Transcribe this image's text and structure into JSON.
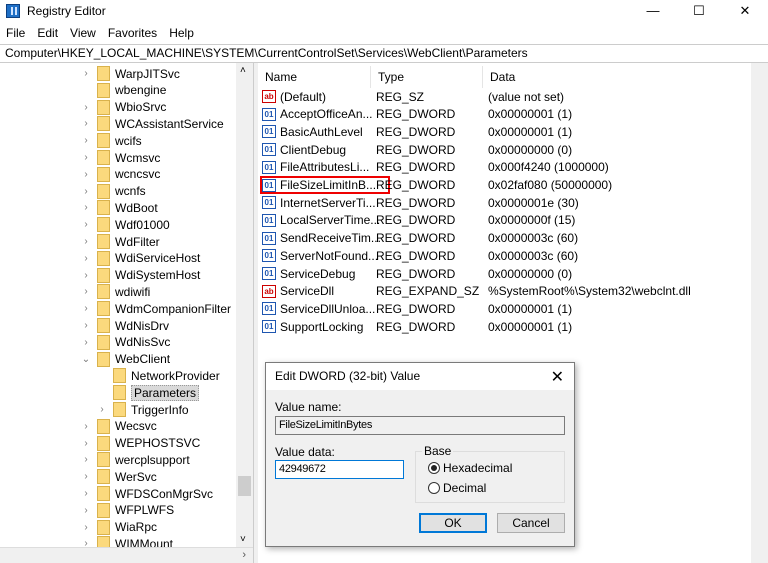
{
  "window": {
    "title": "Registry Editor",
    "minimize": "—",
    "maximize": "☐",
    "close": "✕"
  },
  "menu": [
    "File",
    "Edit",
    "View",
    "Favorites",
    "Help"
  ],
  "address": "Computer\\HKEY_LOCAL_MACHINE\\SYSTEM\\CurrentControlSet\\Services\\WebClient\\Parameters",
  "tree": [
    {
      "label": "WarpJITSvc",
      "level": 1,
      "expander": ">"
    },
    {
      "label": "wbengine",
      "level": 1,
      "expander": ""
    },
    {
      "label": "WbioSrvc",
      "level": 1,
      "expander": ">"
    },
    {
      "label": "WCAssistantService",
      "level": 1,
      "expander": ">"
    },
    {
      "label": "wcifs",
      "level": 1,
      "expander": ">"
    },
    {
      "label": "Wcmsvc",
      "level": 1,
      "expander": ">"
    },
    {
      "label": "wcncsvc",
      "level": 1,
      "expander": ">"
    },
    {
      "label": "wcnfs",
      "level": 1,
      "expander": ">"
    },
    {
      "label": "WdBoot",
      "level": 1,
      "expander": ">"
    },
    {
      "label": "Wdf01000",
      "level": 1,
      "expander": ">"
    },
    {
      "label": "WdFilter",
      "level": 1,
      "expander": ">"
    },
    {
      "label": "WdiServiceHost",
      "level": 1,
      "expander": ">"
    },
    {
      "label": "WdiSystemHost",
      "level": 1,
      "expander": ">"
    },
    {
      "label": "wdiwifi",
      "level": 1,
      "expander": ">"
    },
    {
      "label": "WdmCompanionFilter",
      "level": 1,
      "expander": ">"
    },
    {
      "label": "WdNisDrv",
      "level": 1,
      "expander": ">"
    },
    {
      "label": "WdNisSvc",
      "level": 1,
      "expander": ">"
    },
    {
      "label": "WebClient",
      "level": 1,
      "expander": "v"
    },
    {
      "label": "NetworkProvider",
      "level": 2,
      "expander": ""
    },
    {
      "label": "Parameters",
      "level": 2,
      "expander": "",
      "selected": true
    },
    {
      "label": "TriggerInfo",
      "level": 2,
      "expander": ">"
    },
    {
      "label": "Wecsvc",
      "level": 1,
      "expander": ">"
    },
    {
      "label": "WEPHOSTSVC",
      "level": 1,
      "expander": ">"
    },
    {
      "label": "wercplsupport",
      "level": 1,
      "expander": ">"
    },
    {
      "label": "WerSvc",
      "level": 1,
      "expander": ">"
    },
    {
      "label": "WFDSConMgrSvc",
      "level": 1,
      "expander": ">"
    },
    {
      "label": "WFPLWFS",
      "level": 1,
      "expander": ">"
    },
    {
      "label": "WiaRpc",
      "level": 1,
      "expander": ">"
    },
    {
      "label": "WIMMount",
      "level": 1,
      "expander": ">"
    }
  ],
  "columns": {
    "name": "Name",
    "type": "Type",
    "data": "Data"
  },
  "values": [
    {
      "name": "(Default)",
      "type": "REG_SZ",
      "data": "(value not set)",
      "icon": "ab"
    },
    {
      "name": "AcceptOfficeAn...",
      "type": "REG_DWORD",
      "data": "0x00000001 (1)",
      "icon": "dw"
    },
    {
      "name": "BasicAuthLevel",
      "type": "REG_DWORD",
      "data": "0x00000001 (1)",
      "icon": "dw"
    },
    {
      "name": "ClientDebug",
      "type": "REG_DWORD",
      "data": "0x00000000 (0)",
      "icon": "dw"
    },
    {
      "name": "FileAttributesLi...",
      "type": "REG_DWORD",
      "data": "0x000f4240 (1000000)",
      "icon": "dw"
    },
    {
      "name": "FileSizeLimitInB...",
      "type": "REG_DWORD",
      "data": "0x02faf080 (50000000)",
      "icon": "dw",
      "highlighted": true
    },
    {
      "name": "InternetServerTi...",
      "type": "REG_DWORD",
      "data": "0x0000001e (30)",
      "icon": "dw"
    },
    {
      "name": "LocalServerTime...",
      "type": "REG_DWORD",
      "data": "0x0000000f (15)",
      "icon": "dw"
    },
    {
      "name": "SendReceiveTim...",
      "type": "REG_DWORD",
      "data": "0x0000003c (60)",
      "icon": "dw"
    },
    {
      "name": "ServerNotFound...",
      "type": "REG_DWORD",
      "data": "0x0000003c (60)",
      "icon": "dw"
    },
    {
      "name": "ServiceDebug",
      "type": "REG_DWORD",
      "data": "0x00000000 (0)",
      "icon": "dw"
    },
    {
      "name": "ServiceDll",
      "type": "REG_EXPAND_SZ",
      "data": "%SystemRoot%\\System32\\webclnt.dll",
      "icon": "ab"
    },
    {
      "name": "ServiceDllUnloa...",
      "type": "REG_DWORD",
      "data": "0x00000001 (1)",
      "icon": "dw"
    },
    {
      "name": "SupportLocking",
      "type": "REG_DWORD",
      "data": "0x00000001 (1)",
      "icon": "dw"
    }
  ],
  "dialog": {
    "title": "Edit DWORD (32-bit) Value",
    "close": "✕",
    "value_name_label": "Value name:",
    "value_name": "FileSizeLimitInBytes",
    "value_data_label": "Value data:",
    "value_data": "42949672",
    "base_label": "Base",
    "hex_label": "Hexadecimal",
    "dec_label": "Decimal",
    "base_selected": "hex",
    "ok": "OK",
    "cancel": "Cancel"
  },
  "colors": {
    "highlight": "#e00000",
    "focus": "#0078d7"
  }
}
